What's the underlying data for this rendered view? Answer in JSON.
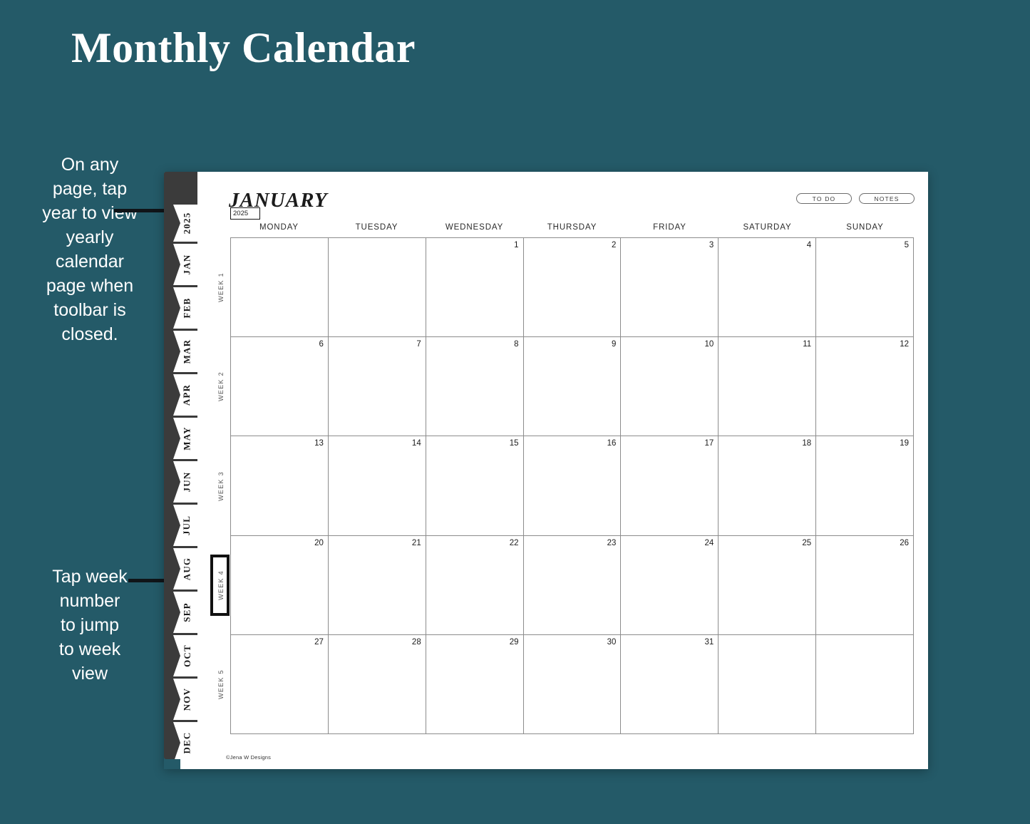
{
  "page": {
    "title": "Monthly Calendar",
    "background_color": "#245a68",
    "accent_dark": "#3b3b3b"
  },
  "annotations": [
    {
      "id": "annotation-top",
      "text": "On any\npage, tap\nyear to view\nyearly\ncalendar\npage when\ntoolbar is\nclosed."
    },
    {
      "id": "annotation-bottom",
      "text": "Tap week\nnumber\nto jump\nto week\nview"
    }
  ],
  "planner": {
    "month_title": "JANUARY",
    "year_value": "2025",
    "copyright": "©Jena W Designs",
    "header_buttons": [
      {
        "label": "TO DO"
      },
      {
        "label": "NOTES"
      }
    ],
    "tab_strip": [
      {
        "label": "2025"
      },
      {
        "label": "JAN"
      },
      {
        "label": "FEB"
      },
      {
        "label": "MAR"
      },
      {
        "label": "APR"
      },
      {
        "label": "MAY"
      },
      {
        "label": "JUN"
      },
      {
        "label": "JUL"
      },
      {
        "label": "AUG"
      },
      {
        "label": "SEP"
      },
      {
        "label": "OCT"
      },
      {
        "label": "NOV"
      },
      {
        "label": "DEC"
      }
    ],
    "weekdays": [
      "MONDAY",
      "TUESDAY",
      "WEDNESDAY",
      "THURSDAY",
      "FRIDAY",
      "SATURDAY",
      "SUNDAY"
    ],
    "week_labels": [
      {
        "label": "WEEK 1",
        "highlighted": false
      },
      {
        "label": "WEEK 2",
        "highlighted": false
      },
      {
        "label": "WEEK 3",
        "highlighted": false
      },
      {
        "label": "WEEK 4",
        "highlighted": true
      },
      {
        "label": "WEEK 5",
        "highlighted": false
      }
    ],
    "grid": [
      [
        "",
        "",
        "1",
        "2",
        "3",
        "4",
        "5"
      ],
      [
        "6",
        "7",
        "8",
        "9",
        "10",
        "11",
        "12"
      ],
      [
        "13",
        "14",
        "15",
        "16",
        "17",
        "18",
        "19"
      ],
      [
        "20",
        "21",
        "22",
        "23",
        "24",
        "25",
        "26"
      ],
      [
        "27",
        "28",
        "29",
        "30",
        "31",
        "",
        ""
      ]
    ]
  }
}
